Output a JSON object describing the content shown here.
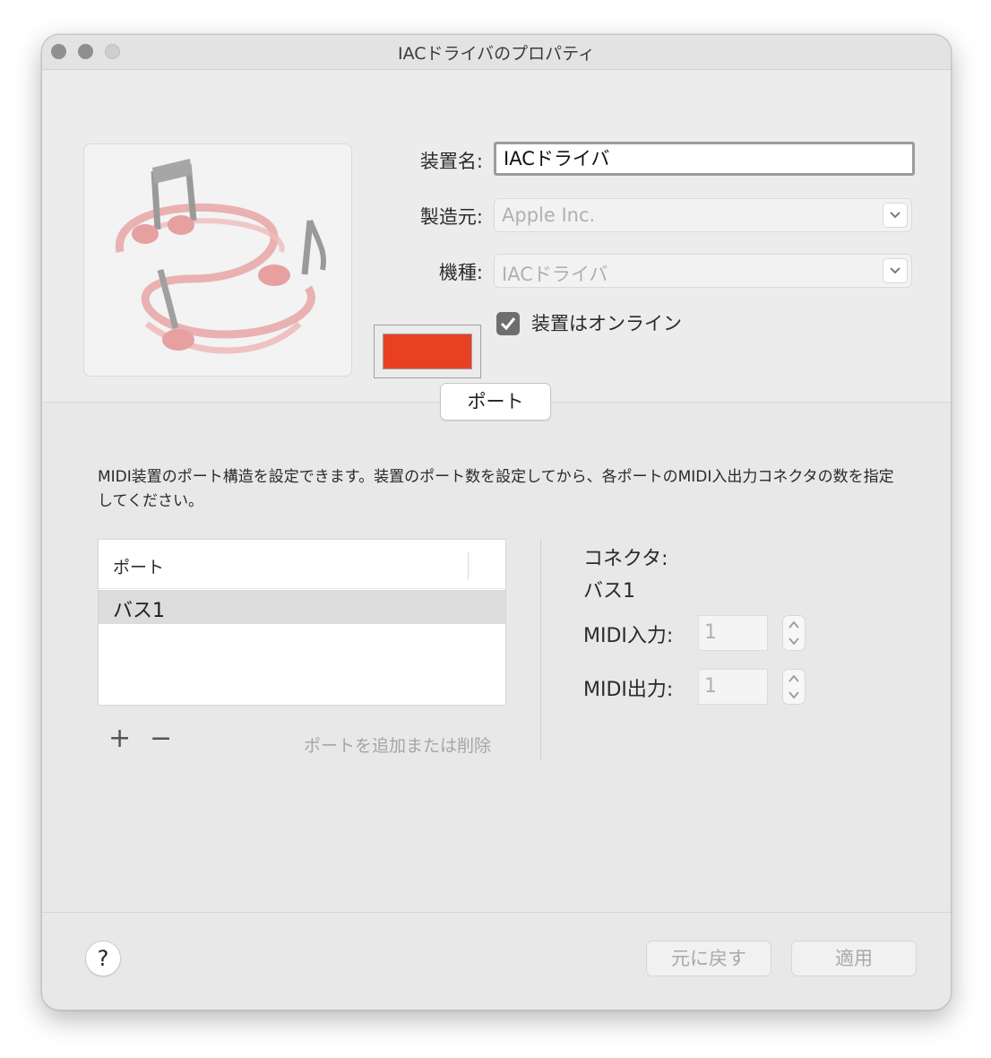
{
  "window": {
    "title": "IACドライバのプロパティ"
  },
  "device": {
    "name_label": "装置名:",
    "name_value": "IACドライバ",
    "manufacturer_label": "製造元:",
    "manufacturer_value": "Apple Inc.",
    "model_label": "機種:",
    "model_value": "IACドライバ",
    "online_label": "装置はオンライン",
    "online_checked": true,
    "color": "#e84023"
  },
  "tab": {
    "label": "ポート"
  },
  "description": "MIDI装置のポート構造を設定できます。装置のポート数を設定してから、各ポートのMIDI入出力コネクタの数を指定してください。",
  "ports": {
    "header": "ポート",
    "rows": [
      "バス1"
    ],
    "add_label": "+",
    "remove_label": "−",
    "hint": "ポートを追加または削除"
  },
  "connector": {
    "title": "コネクタ:",
    "port_name": "バス1",
    "midi_in_label": "MIDI入力:",
    "midi_in_value": "1",
    "midi_out_label": "MIDI出力:",
    "midi_out_value": "1"
  },
  "footer": {
    "help_label": "?",
    "revert_label": "元に戻す",
    "apply_label": "適用"
  }
}
